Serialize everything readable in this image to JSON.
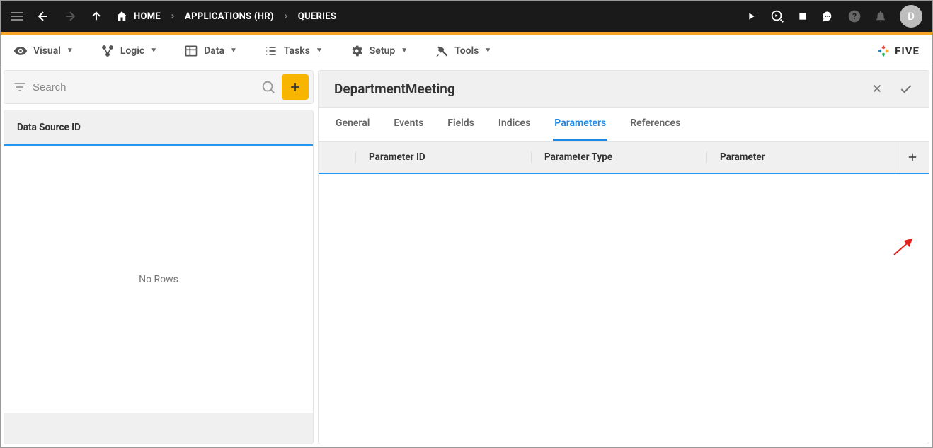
{
  "topbar": {
    "breadcrumb": {
      "home": "HOME",
      "app": "APPLICATIONS (HR)",
      "section": "QUERIES"
    },
    "avatar": "D"
  },
  "menubar": {
    "visual": "Visual",
    "logic": "Logic",
    "data": "Data",
    "tasks": "Tasks",
    "setup": "Setup",
    "tools": "Tools",
    "brand": "FIVE"
  },
  "left": {
    "search_placeholder": "Search",
    "column_header": "Data Source ID",
    "empty_text": "No Rows"
  },
  "detail": {
    "title": "DepartmentMeeting",
    "tabs": {
      "general": "General",
      "events": "Events",
      "fields": "Fields",
      "indices": "Indices",
      "parameters": "Parameters",
      "references": "References"
    },
    "active_tab": "parameters",
    "grid": {
      "col1": "Parameter ID",
      "col2": "Parameter Type",
      "col3": "Parameter"
    }
  }
}
